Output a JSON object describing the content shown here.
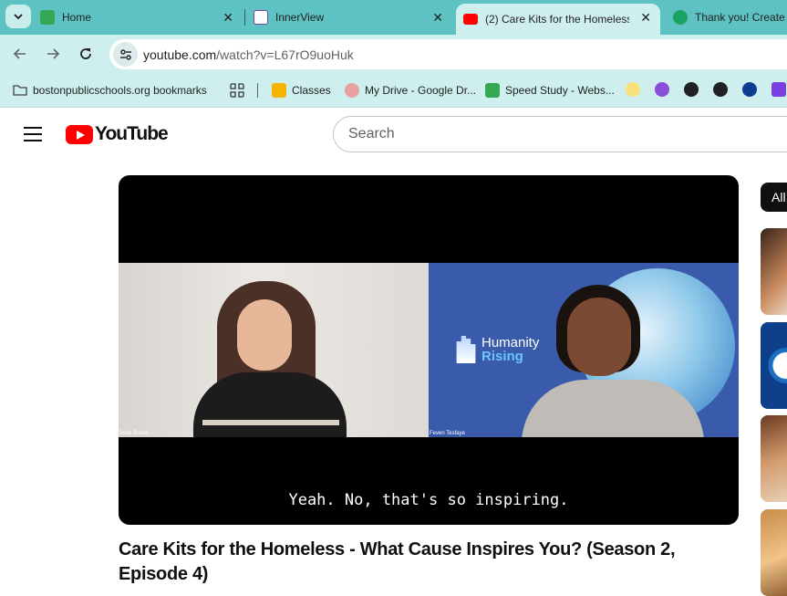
{
  "browser": {
    "tabs": [
      {
        "title": "Home",
        "favicon_color": "#34a853"
      },
      {
        "title": "InnerView",
        "favicon_color": "#7b3fa0"
      },
      {
        "title": "(2) Care Kits for the Homeless",
        "favicon_color": "#ff0000"
      },
      {
        "title": "Thank you! Create",
        "favicon_color": "#1aa260"
      }
    ],
    "close_glyph": "✕",
    "url_host": "youtube.com",
    "url_path": "/watch?v=L67rO9uoHuk"
  },
  "bookmarks": [
    {
      "label": "bostonpublicschools.org bookmarks"
    },
    {
      "label": "Classes"
    },
    {
      "label": "My Drive - Google Dr..."
    },
    {
      "label": "Speed Study - Webs..."
    }
  ],
  "youtube": {
    "logo_text": "YouTube",
    "search_placeholder": "Search"
  },
  "video": {
    "participant_left": "Bella Brown",
    "participant_right": "Feven Tesfaye",
    "brand_line1": "Humanity",
    "brand_line2": "Rising",
    "caption": "Yeah. No, that's so inspiring.",
    "title": "Care Kits for the Homeless - What Cause Inspires You? (Season 2, Episode 4)"
  },
  "sidebar": {
    "chip_label": "All"
  },
  "colors": {
    "tabstrip": "#5fc2c2",
    "toolbar": "#cfeeee",
    "youtube_red": "#ff0000"
  }
}
